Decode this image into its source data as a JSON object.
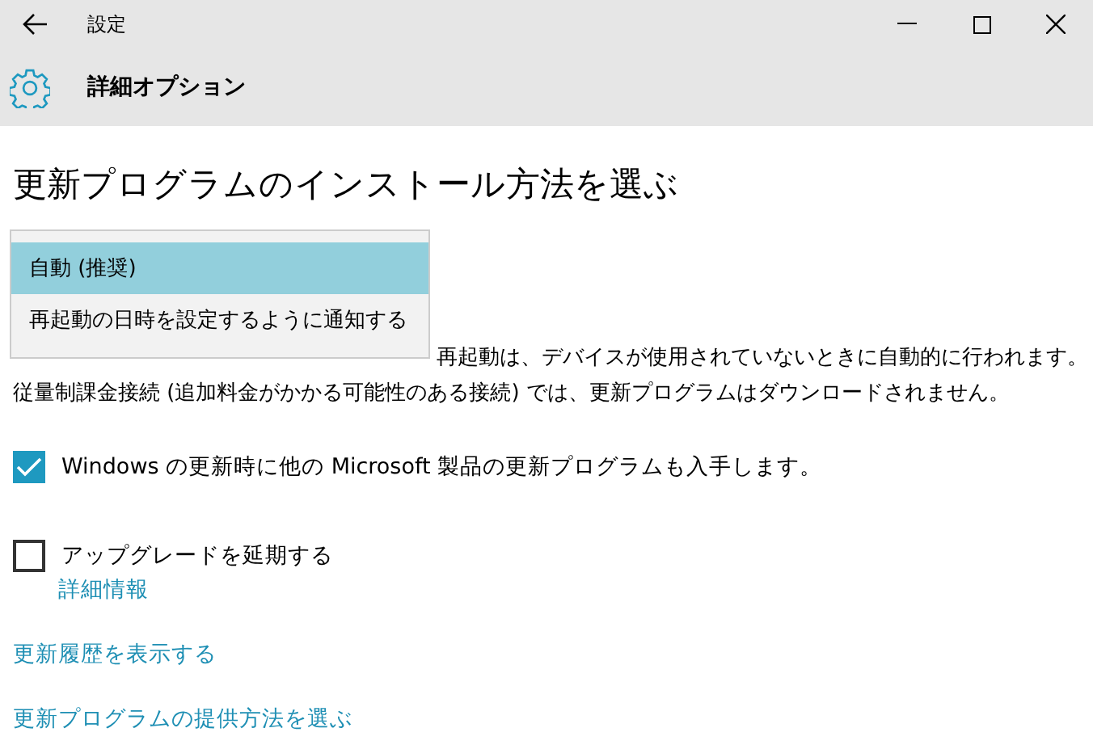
{
  "window": {
    "title": "設定"
  },
  "header": {
    "title": "詳細オプション"
  },
  "heading": "更新プログラムのインストール方法を選ぶ",
  "dropdown": {
    "options": [
      {
        "label": "自動 (推奨)",
        "selected": true
      },
      {
        "label": "再起動の日時を設定するように通知する",
        "selected": false
      }
    ]
  },
  "description": [
    "再起動は、デバイスが使用されていないときに自動的に行われます。",
    "従量制課金接続 (追加料金がかかる可能性のある接続) では、更新プログラムはダウンロードされません。"
  ],
  "options": [
    {
      "label": "Windows の更新時に他の Microsoft 製品の更新プログラムも入手します。",
      "checked": true
    },
    {
      "label": "アップグレードを延期する",
      "checked": false,
      "link": "詳細情報"
    }
  ],
  "links": [
    "更新履歴を表示する",
    "更新プログラムの提供方法を選ぶ"
  ]
}
